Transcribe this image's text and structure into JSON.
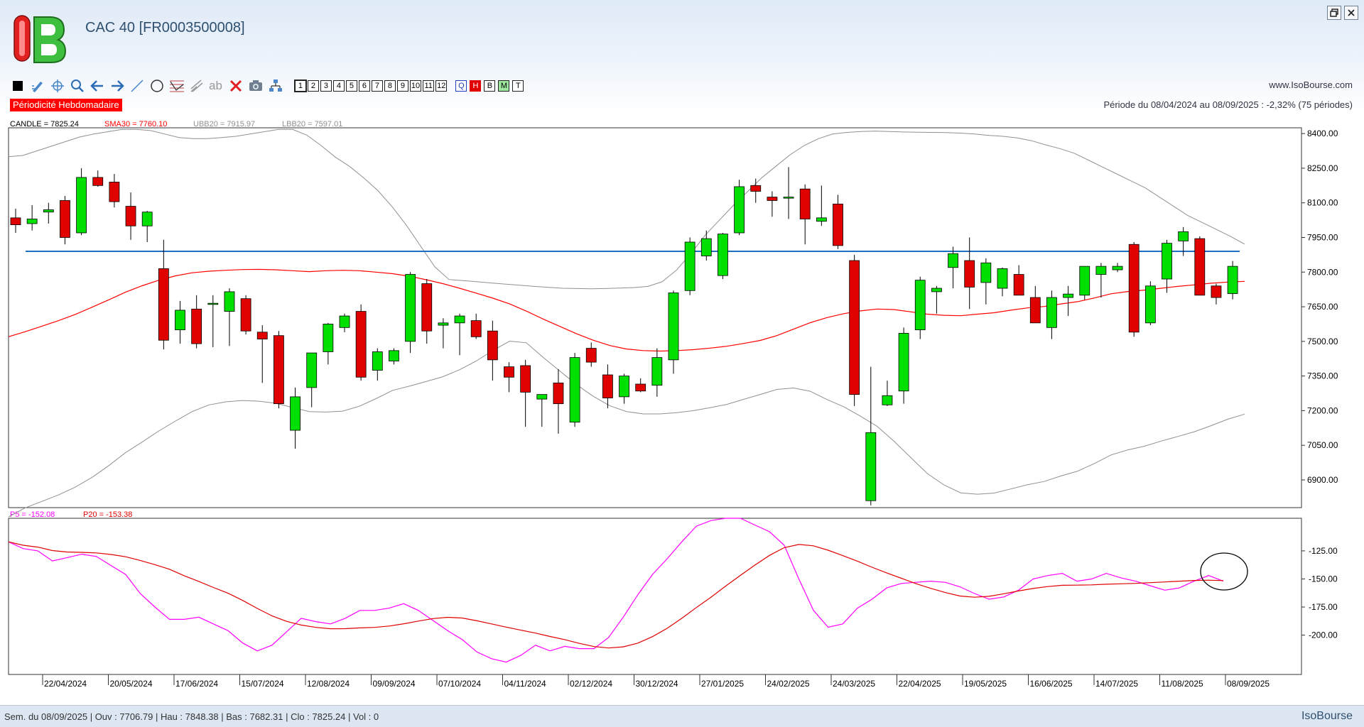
{
  "header": {
    "title": "CAC 40 [FR0003500008]",
    "logo_text": "IB",
    "site": "www.IsoBourse.com",
    "periodicity": "Périodicité Hebdomadaire",
    "period_range": "Période du 08/04/2024 au 08/09/2025 : -2,32% (75 périodes)"
  },
  "window_buttons": [
    "restore",
    "close"
  ],
  "toolbar": {
    "tools": [
      "color-square-icon",
      "pencil-icon",
      "crosshair-icon",
      "zoom-icon",
      "arrow-left-icon",
      "arrow-right-icon",
      "line-icon",
      "circle-icon",
      "fibo-icon",
      "channel-icon",
      "text-tool-icon",
      "delete-icon",
      "camera-icon",
      "tree-icon"
    ],
    "text_tool": "ab",
    "period_buttons": [
      "1",
      "2",
      "3",
      "4",
      "5",
      "6",
      "7",
      "8",
      "9",
      "10",
      "11",
      "12"
    ],
    "mode_buttons": [
      "Q",
      "H",
      "B",
      "M",
      "T"
    ],
    "selected_mode": "H"
  },
  "colors": {
    "up": "#00e000",
    "down": "#e00000",
    "sma": "#ff0000",
    "bands": "#909090",
    "hline": "#1e6fbf",
    "p5": "#ff00ff",
    "p20": "#e00000",
    "highlight_label": "#ff0000"
  },
  "chart_data": [
    {
      "type": "candlestick",
      "legend": {
        "candle": "CANDLE = 7825.24",
        "sma": "SMA30 = 7760.10",
        "ubb": "UBB20 = 7915.97",
        "lbb": "LBB20 = 7597.01"
      },
      "ylim": [
        6780,
        8425
      ],
      "y_ticks": [
        "8400.00",
        "8250.00",
        "8100.00",
        "7950.00",
        "7800.00",
        "7650.00",
        "7500.00",
        "7350.00",
        "7200.00",
        "7050.00",
        "6900.00"
      ],
      "x_labels": [
        "22/04/2024",
        "20/05/2024",
        "17/06/2024",
        "15/07/2024",
        "12/08/2024",
        "09/09/2024",
        "07/10/2024",
        "04/11/2024",
        "02/12/2024",
        "30/12/2024",
        "27/01/2025",
        "24/02/2025",
        "24/03/2025",
        "22/04/2025",
        "19/05/2025",
        "16/06/2025",
        "14/07/2025",
        "11/08/2025",
        "08/09/2025"
      ],
      "horizontal_line": 7890,
      "candles": [
        [
          8035,
          8075,
          7970,
          8005
        ],
        [
          8010,
          8090,
          7980,
          8030
        ],
        [
          8060,
          8100,
          8010,
          8070
        ],
        [
          8110,
          8130,
          7920,
          7950
        ],
        [
          7970,
          8250,
          7960,
          8210
        ],
        [
          8210,
          8240,
          8170,
          8175
        ],
        [
          8190,
          8225,
          8080,
          8105
        ],
        [
          8085,
          8145,
          7940,
          8000
        ],
        [
          8000,
          8065,
          7930,
          8060
        ],
        [
          7815,
          7940,
          7465,
          7505
        ],
        [
          7550,
          7675,
          7490,
          7635
        ],
        [
          7640,
          7700,
          7470,
          7490
        ],
        [
          7660,
          7700,
          7475,
          7665
        ],
        [
          7630,
          7730,
          7480,
          7715
        ],
        [
          7685,
          7700,
          7530,
          7545
        ],
        [
          7540,
          7570,
          7320,
          7510
        ],
        [
          7525,
          7545,
          7210,
          7230
        ],
        [
          7115,
          7300,
          7035,
          7260
        ],
        [
          7300,
          7450,
          7215,
          7450
        ],
        [
          7455,
          7580,
          7400,
          7575
        ],
        [
          7560,
          7620,
          7540,
          7610
        ],
        [
          7630,
          7660,
          7330,
          7345
        ],
        [
          7375,
          7470,
          7330,
          7455
        ],
        [
          7415,
          7470,
          7400,
          7460
        ],
        [
          7500,
          7800,
          7450,
          7790
        ],
        [
          7750,
          7770,
          7490,
          7545
        ],
        [
          7570,
          7600,
          7470,
          7580
        ],
        [
          7580,
          7620,
          7440,
          7610
        ],
        [
          7590,
          7620,
          7510,
          7520
        ],
        [
          7545,
          7590,
          7330,
          7420
        ],
        [
          7390,
          7410,
          7280,
          7345
        ],
        [
          7395,
          7420,
          7130,
          7280
        ],
        [
          7250,
          7270,
          7130,
          7270
        ],
        [
          7320,
          7380,
          7100,
          7230
        ],
        [
          7150,
          7450,
          7130,
          7430
        ],
        [
          7470,
          7495,
          7390,
          7410
        ],
        [
          7355,
          7400,
          7210,
          7255
        ],
        [
          7260,
          7360,
          7230,
          7350
        ],
        [
          7315,
          7340,
          7280,
          7285
        ],
        [
          7310,
          7470,
          7260,
          7430
        ],
        [
          7420,
          7720,
          7360,
          7710
        ],
        [
          7720,
          7950,
          7700,
          7930
        ],
        [
          7870,
          7980,
          7850,
          7945
        ],
        [
          7785,
          7970,
          7770,
          7965
        ],
        [
          7970,
          8200,
          7960,
          8170
        ],
        [
          8175,
          8205,
          8100,
          8150
        ],
        [
          8125,
          8150,
          8040,
          8110
        ],
        [
          8120,
          8255,
          8030,
          8125
        ],
        [
          8160,
          8180,
          7920,
          8030
        ],
        [
          8020,
          8175,
          8000,
          8035
        ],
        [
          8095,
          8135,
          7900,
          7915
        ],
        [
          7850,
          7875,
          7220,
          7270
        ],
        [
          6810,
          7390,
          6790,
          7105
        ],
        [
          7225,
          7330,
          7220,
          7265
        ],
        [
          7285,
          7560,
          7230,
          7535
        ],
        [
          7550,
          7780,
          7510,
          7765
        ],
        [
          7715,
          7740,
          7620,
          7730
        ],
        [
          7820,
          7910,
          7730,
          7880
        ],
        [
          7850,
          7950,
          7640,
          7735
        ],
        [
          7755,
          7860,
          7660,
          7840
        ],
        [
          7730,
          7820,
          7695,
          7815
        ],
        [
          7790,
          7830,
          7700,
          7700
        ],
        [
          7690,
          7740,
          7580,
          7580
        ],
        [
          7560,
          7720,
          7510,
          7690
        ],
        [
          7690,
          7740,
          7610,
          7705
        ],
        [
          7700,
          7825,
          7680,
          7825
        ],
        [
          7790,
          7840,
          7690,
          7825
        ],
        [
          7810,
          7840,
          7800,
          7825
        ],
        [
          7920,
          7930,
          7520,
          7540
        ],
        [
          7580,
          7760,
          7570,
          7740
        ],
        [
          7770,
          7940,
          7710,
          7925
        ],
        [
          7935,
          7995,
          7870,
          7975
        ],
        [
          7945,
          7955,
          7840,
          7700
        ],
        [
          7740,
          7750,
          7660,
          7690
        ],
        [
          7707,
          7848,
          7682,
          7825
        ]
      ],
      "sma30": [
        7520,
        7542,
        7566,
        7590,
        7617,
        7648,
        7680,
        7713,
        7741,
        7765,
        7784,
        7797,
        7804,
        7808,
        7811,
        7812,
        7810,
        7806,
        7802,
        7806,
        7808,
        7806,
        7800,
        7793,
        7782,
        7767,
        7750,
        7730,
        7709,
        7687,
        7662,
        7631,
        7597,
        7565,
        7533,
        7505,
        7482,
        7467,
        7460,
        7458,
        7460,
        7464,
        7471,
        7479,
        7491,
        7504,
        7525,
        7553,
        7581,
        7603,
        7620,
        7632,
        7640,
        7638,
        7628,
        7618,
        7613,
        7611,
        7618,
        7624,
        7635,
        7645,
        7651,
        7662,
        7672,
        7688,
        7706,
        7716,
        7722,
        7730,
        7738,
        7745,
        7752,
        7757,
        7760
      ],
      "ubb20": [
        8300,
        8305,
        8325,
        8345,
        8365,
        8385,
        8398,
        8408,
        8418,
        8418,
        8413,
        8398,
        8383,
        8378,
        8378,
        8383,
        8388,
        8398,
        8408,
        8418,
        8418,
        8393,
        8348,
        8298,
        8258,
        8208,
        8153,
        8083,
        8003,
        7913,
        7823,
        7768,
        7763,
        7758,
        7753,
        7748,
        7743,
        7738,
        7734,
        7730,
        7729,
        7728,
        7729,
        7731,
        7733,
        7738,
        7758,
        7808,
        7878,
        7958,
        8023,
        8088,
        8148,
        8208,
        8258,
        8308,
        8348,
        8378,
        8398,
        8405,
        8409,
        8411,
        8409,
        8407,
        8406,
        8405,
        8404,
        8402,
        8398,
        8392,
        8388,
        8381,
        8369,
        8351,
        8335,
        8315,
        8285,
        8255,
        8225,
        8195,
        8165,
        8125,
        8085,
        8045,
        8015,
        7985,
        7955,
        7921
      ]
    },
    {
      "type": "line",
      "legend": {
        "p5": "P5 = -152.08",
        "p20": "P20 = -153.38"
      },
      "ylim": [
        -235,
        -96
      ],
      "y_ticks": [
        "-125.00",
        "-150.00",
        "-175.00",
        "-200.00"
      ],
      "p5": [
        -117,
        -123,
        -125,
        -134,
        -131,
        -128,
        -130,
        -138,
        -146,
        -163,
        -175,
        -186,
        -186,
        -184,
        -190,
        -196,
        -207,
        -214,
        -209,
        -197,
        -185,
        -188,
        -190,
        -185,
        -178,
        -178,
        -176,
        -172,
        -178,
        -187,
        -196,
        -204,
        -215,
        -221,
        -224,
        -218,
        -209,
        -214,
        -210,
        -212,
        -212,
        -202,
        -184,
        -164,
        -146,
        -132,
        -117,
        -103,
        -98,
        -96,
        -96,
        -102,
        -108,
        -120,
        -150,
        -178,
        -193,
        -190,
        -176,
        -168,
        -158,
        -154,
        -153,
        -152,
        -153,
        -157,
        -163,
        -168,
        -166,
        -160,
        -150,
        -147,
        -145,
        -152,
        -150,
        -145,
        -149,
        -152,
        -156,
        -160,
        -158,
        -152,
        -147,
        -152
      ]
    }
  ]
}
